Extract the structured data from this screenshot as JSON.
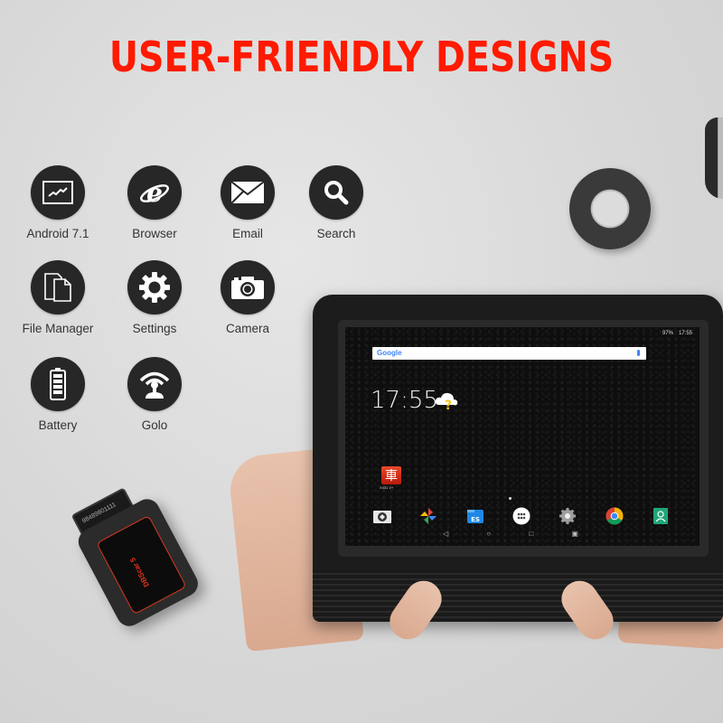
{
  "headline": "USER-FRIENDLY DESIGNS",
  "colors": {
    "headline": "#ff1a00",
    "icon_circle": "#272727",
    "label": "#333333",
    "background": "#d8d8d8"
  },
  "features": [
    {
      "label": "Android 7.1",
      "icon": "chart-monitor-icon"
    },
    {
      "label": "Browser",
      "icon": "internet-explorer-icon"
    },
    {
      "label": "Email",
      "icon": "envelope-icon"
    },
    {
      "label": "Search",
      "icon": "magnifier-icon"
    },
    {
      "label": "File Manager",
      "icon": "documents-icon"
    },
    {
      "label": "Settings",
      "icon": "gear-icon"
    },
    {
      "label": "Camera",
      "icon": "camera-icon"
    },
    {
      "label": "Battery",
      "icon": "battery-icon"
    },
    {
      "label": "Golo",
      "icon": "golo-signal-icon"
    }
  ],
  "dongle": {
    "brand": "DBScar 5",
    "serial": "98489801111"
  },
  "tablet": {
    "status_bar": {
      "battery": "97%",
      "time": "17:55"
    },
    "search": {
      "logo": "Google"
    },
    "clock": "17:55",
    "home_app": {
      "label": "X431 V+",
      "glyph": "車"
    },
    "dock_apps": [
      {
        "name": "camera-app",
        "icon": "camera-app-icon"
      },
      {
        "name": "photos-app",
        "icon": "pinwheel-icon"
      },
      {
        "name": "es-file-explorer-app",
        "icon": "folder-es-icon"
      },
      {
        "name": "app-drawer",
        "icon": "app-drawer-icon"
      },
      {
        "name": "settings-app",
        "icon": "gear-icon"
      },
      {
        "name": "chrome-app",
        "icon": "chrome-icon"
      },
      {
        "name": "contacts-app",
        "icon": "contacts-icon"
      }
    ],
    "nav": {
      "back": "◁",
      "home": "○",
      "recents": "□",
      "screenshot": "▣"
    }
  }
}
